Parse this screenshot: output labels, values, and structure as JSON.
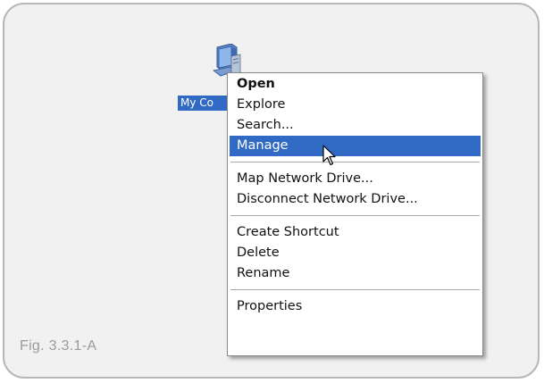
{
  "desktop_icon": {
    "label": "My Co",
    "icon": "my-computer-icon"
  },
  "context_menu": {
    "groups": [
      [
        {
          "label": "Open",
          "bold": true
        },
        {
          "label": "Explore"
        },
        {
          "label": "Search..."
        },
        {
          "label": "Manage",
          "active": true
        }
      ],
      [
        {
          "label": "Map Network Drive..."
        },
        {
          "label": "Disconnect Network Drive..."
        }
      ],
      [
        {
          "label": "Create Shortcut"
        },
        {
          "label": "Delete"
        },
        {
          "label": "Rename"
        }
      ],
      [
        {
          "label": "Properties"
        }
      ]
    ]
  },
  "caption": "Fig. 3.3.1-A",
  "colors": {
    "highlight": "#316ac5",
    "frame_border": "#b7b7b7",
    "background": "#f1f1f1"
  },
  "cursor_icon": "arrow-cursor-icon"
}
